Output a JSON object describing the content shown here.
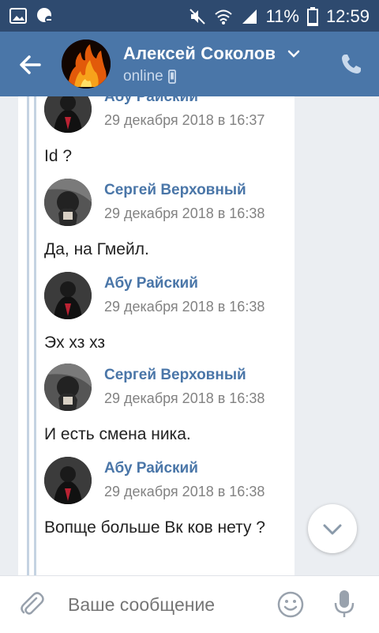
{
  "status_bar": {
    "battery": "11%",
    "time": "12:59"
  },
  "header": {
    "name": "Алексей Соколов",
    "status": "online"
  },
  "messages": [
    {
      "author": "Абу Райский",
      "time": "29 декабря 2018 в 16:37",
      "text": "Id ?"
    },
    {
      "author": "Сергей Верховный",
      "time": "29 декабря 2018 в 16:38",
      "text": "Да, на Гмейл."
    },
    {
      "author": "Абу Райский",
      "time": "29 декабря 2018 в 16:38",
      "text": "Эх хз хз"
    },
    {
      "author": "Сергей Верховный",
      "time": "29 декабря 2018 в 16:38",
      "text": "И есть смена ника."
    },
    {
      "author": "Абу Райский",
      "time": "29 декабря 2018 в 16:38",
      "text": "Вопще больше Вк ков нету ?"
    }
  ],
  "composer": {
    "placeholder": "Ваше сообщение"
  },
  "colors": {
    "header": "#4a76a8",
    "status_bar": "#2e4a6f",
    "author": "#4a76a8"
  }
}
